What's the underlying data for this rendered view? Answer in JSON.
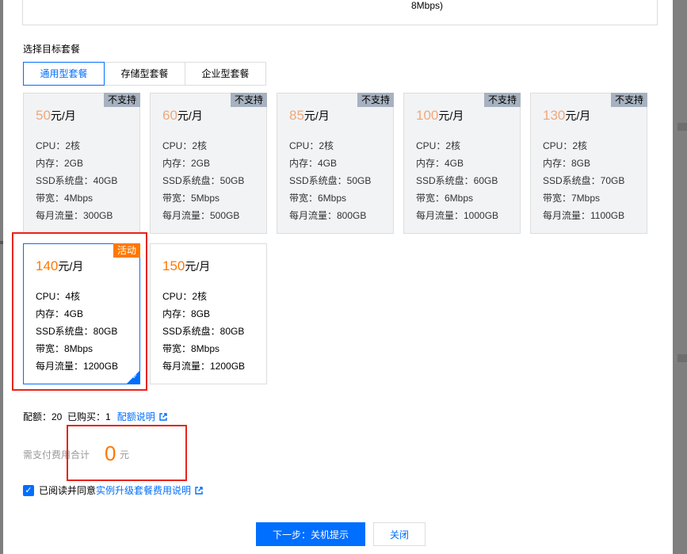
{
  "top_box": {
    "bandwidth_fragment": "8Mbps)"
  },
  "section_title": "选择目标套餐",
  "tabs": [
    {
      "label": "通用型套餐",
      "active": true
    },
    {
      "label": "存储型套餐",
      "active": false
    },
    {
      "label": "企业型套餐",
      "active": false
    }
  ],
  "packages": [
    {
      "price": "50",
      "unit": "元/月",
      "badge": "不支持",
      "cpu": "CPU：2核",
      "mem": "内存：2GB",
      "ssd": "SSD系统盘：40GB",
      "bw": "带宽：4Mbps",
      "traffic": "每月流量：300GB"
    },
    {
      "price": "60",
      "unit": "元/月",
      "badge": "不支持",
      "cpu": "CPU：2核",
      "mem": "内存：2GB",
      "ssd": "SSD系统盘：50GB",
      "bw": "带宽：5Mbps",
      "traffic": "每月流量：500GB"
    },
    {
      "price": "85",
      "unit": "元/月",
      "badge": "不支持",
      "cpu": "CPU：2核",
      "mem": "内存：4GB",
      "ssd": "SSD系统盘：50GB",
      "bw": "带宽：6Mbps",
      "traffic": "每月流量：800GB"
    },
    {
      "price": "100",
      "unit": "元/月",
      "badge": "不支持",
      "cpu": "CPU：2核",
      "mem": "内存：4GB",
      "ssd": "SSD系统盘：60GB",
      "bw": "带宽：6Mbps",
      "traffic": "每月流量：1000GB"
    },
    {
      "price": "130",
      "unit": "元/月",
      "badge": "不支持",
      "cpu": "CPU：2核",
      "mem": "内存：8GB",
      "ssd": "SSD系统盘：70GB",
      "bw": "带宽：7Mbps",
      "traffic": "每月流量：1100GB"
    },
    {
      "price": "140",
      "unit": "元/月",
      "badge": "活动",
      "cpu": "CPU：4核",
      "mem": "内存：4GB",
      "ssd": "SSD系统盘：80GB",
      "bw": "带宽：8Mbps",
      "traffic": "每月流量：1200GB"
    },
    {
      "price": "150",
      "unit": "元/月",
      "badge": "",
      "cpu": "CPU：2核",
      "mem": "内存：8GB",
      "ssd": "SSD系统盘：80GB",
      "bw": "带宽：8Mbps",
      "traffic": "每月流量：1200GB"
    }
  ],
  "quota": {
    "text": "配额：20  已购买：1",
    "link": "配额说明"
  },
  "payment": {
    "label": "需支付费用合计",
    "amount": "0",
    "unit": "元"
  },
  "agreement": {
    "prefix": "已阅读并同意",
    "link": "实例升级套餐费用说明"
  },
  "buttons": {
    "next": "下一步：关机提示",
    "close": "关闭"
  },
  "colors": {
    "accent": "#006eff",
    "price": "#ff7800",
    "annotation": "#e8231b"
  }
}
